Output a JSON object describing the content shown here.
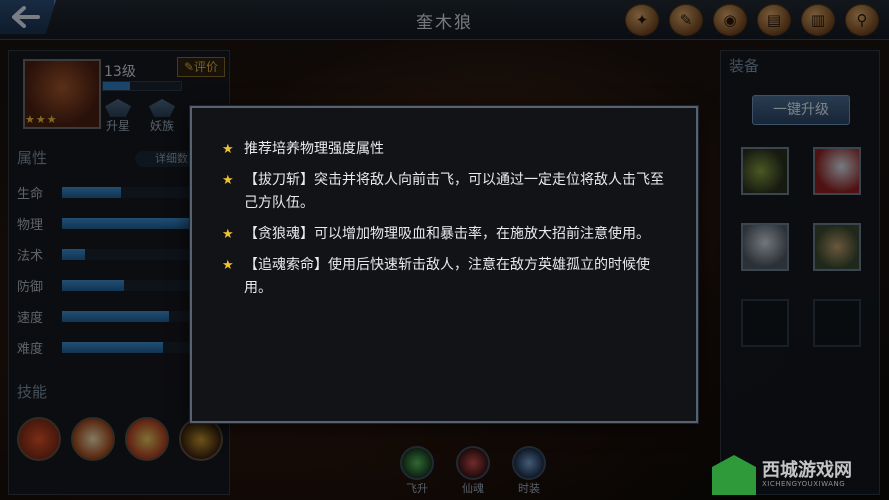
{
  "header": {
    "title": "奎木狼",
    "back_icon": "back-arrow-icon",
    "icons": [
      "compass-icon",
      "scroll-icon",
      "coin-icon",
      "map-icon",
      "book-icon",
      "magnifier-icon"
    ]
  },
  "hero": {
    "level": "13级",
    "level_progress": 0.35,
    "stars": 3,
    "rate_label": "评价",
    "upgrade_star_label": "升星",
    "awaken_label": "妖族"
  },
  "attributes": {
    "title": "属性",
    "detail_label": "详细数",
    "items": [
      {
        "label": "生命",
        "value": 0.45
      },
      {
        "label": "物理",
        "value": 0.98
      },
      {
        "label": "法术",
        "value": 0.18
      },
      {
        "label": "防御",
        "value": 0.48
      },
      {
        "label": "速度",
        "value": 0.82
      },
      {
        "label": "难度",
        "value": 0.78
      }
    ]
  },
  "skills": {
    "title": "技能",
    "items": [
      "skill-1-icon",
      "skill-2-icon",
      "skill-3-icon",
      "skill-4-icon"
    ]
  },
  "equipment": {
    "title": "装备",
    "upgrade_all_label": "一键升级"
  },
  "bottom_tabs": [
    {
      "label": "飞升"
    },
    {
      "label": "仙魂"
    },
    {
      "label": "时装"
    }
  ],
  "dialog": {
    "tips": [
      "推荐培养物理强度属性",
      "【拔刀斩】突击并将敌人向前击飞，可以通过一定走位将敌人击飞至己方队伍。",
      "【贪狼魂】可以增加物理吸血和暴击率，在施放大招前注意使用。",
      "【追魂索命】使用后快速斩击敌人，注意在敌方英雄孤立的时候使用。"
    ]
  },
  "watermark": {
    "name": "西城游戏网",
    "sub": "XICHENGYOUXIWANG"
  },
  "colors": {
    "accent": "#2c7fc0",
    "star": "#f2c233",
    "watermark_green": "#2f9a3a"
  }
}
